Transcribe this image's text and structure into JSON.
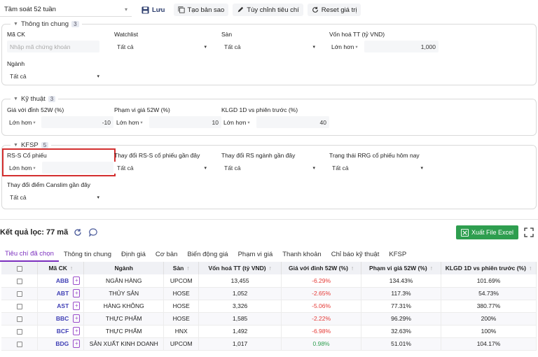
{
  "toolbar": {
    "preset": "Tầm soát 52 tuần",
    "save": "Lưu",
    "copy": "Tạo bản sao",
    "customize": "Tùy chỉnh tiêu chí",
    "reset": "Reset giá trị"
  },
  "general": {
    "title": "Thông tin chung",
    "count": "3",
    "stock_code": {
      "label": "Mã CK",
      "placeholder": "Nhập mã chứng khoán"
    },
    "watchlist": {
      "label": "Watchlist",
      "value": "Tất cả"
    },
    "exchange": {
      "label": "Sàn",
      "value": "Tất cả"
    },
    "market_cap": {
      "label": "Vốn hoá TT (tỷ VND)",
      "op": "Lớn hơn",
      "value": "1,000"
    },
    "industry": {
      "label": "Ngành",
      "value": "Tất cả"
    }
  },
  "technical": {
    "title": "Kỹ thuật",
    "count": "3",
    "vs_peak": {
      "label": "Giá với đỉnh 52W (%)",
      "op": "Lớn hơn",
      "value": "-10"
    },
    "range52": {
      "label": "Phạm vi giá 52W (%)",
      "op": "Lớn hơn",
      "value": "10"
    },
    "volume": {
      "label": "KLGD 1D vs phiên trước (%)",
      "op": "Lớn hơn",
      "value": "40"
    }
  },
  "kfsp": {
    "title": "KFSP",
    "count": "5",
    "rs_stock": {
      "label": "RS-S Cổ phiếu",
      "op": "Lớn hơn",
      "value": ""
    },
    "rs_change": {
      "label": "Thay đổi RS-S cổ phiếu gần đây",
      "value": "Tất cả"
    },
    "rs_industry": {
      "label": "Thay đổi RS ngành gần đây",
      "value": "Tất cả"
    },
    "rrg_state": {
      "label": "Trạng thái RRG cổ phiếu hôm nay",
      "value": "Tất cả"
    },
    "canslim": {
      "label": "Thay đổi điểm Canslim gần đây",
      "value": "Tất cả"
    }
  },
  "results": {
    "title": "Kết quả lọc: 77 mã",
    "export": "Xuất File Excel"
  },
  "tabs": [
    "Tiêu chí đã chọn",
    "Thông tin chung",
    "Định giá",
    "Cơ bản",
    "Biến động giá",
    "Phạm vi giá",
    "Thanh khoản",
    "Chỉ báo kỹ thuật",
    "KFSP"
  ],
  "table": {
    "headers": [
      "Mã CK",
      "Ngành",
      "Sàn",
      "Vốn hoá TT (tỷ VND)",
      "Giá với đỉnh 52W (%)",
      "Phạm vi giá 52W (%)",
      "KLGD 1D vs phiên trước (%)"
    ],
    "rows": [
      {
        "code": "ABB",
        "industry": "NGÂN HÀNG",
        "exchange": "UPCOM",
        "cap": "13,455",
        "peak": "-6.29%",
        "range": "134.43%",
        "vol": "101.69%"
      },
      {
        "code": "ABT",
        "industry": "THỦY SẢN",
        "exchange": "HOSE",
        "cap": "1,052",
        "peak": "-2.65%",
        "range": "117.3%",
        "vol": "54.73%"
      },
      {
        "code": "AST",
        "industry": "HÀNG KHÔNG",
        "exchange": "HOSE",
        "cap": "3,326",
        "peak": "-5.06%",
        "range": "77.31%",
        "vol": "380.77%"
      },
      {
        "code": "BBC",
        "industry": "THỰC PHẨM",
        "exchange": "HOSE",
        "cap": "1,585",
        "peak": "-2.22%",
        "range": "96.29%",
        "vol": "200%"
      },
      {
        "code": "BCF",
        "industry": "THỰC PHẨM",
        "exchange": "HNX",
        "cap": "1,492",
        "peak": "-6.98%",
        "range": "32.63%",
        "vol": "100%"
      },
      {
        "code": "BDG",
        "industry": "SẢN XUẤT KINH DOANH",
        "exchange": "UPCOM",
        "cap": "1,017",
        "peak": "0.98%",
        "range": "51.01%",
        "vol": "104.17%"
      }
    ]
  },
  "colors": {
    "accent": "#7b2fbe",
    "link": "#3f3fb5",
    "negative": "#e53935",
    "positive": "#2e9e4f",
    "export": "#2e9e4f",
    "highlight": "#d32f2f"
  }
}
